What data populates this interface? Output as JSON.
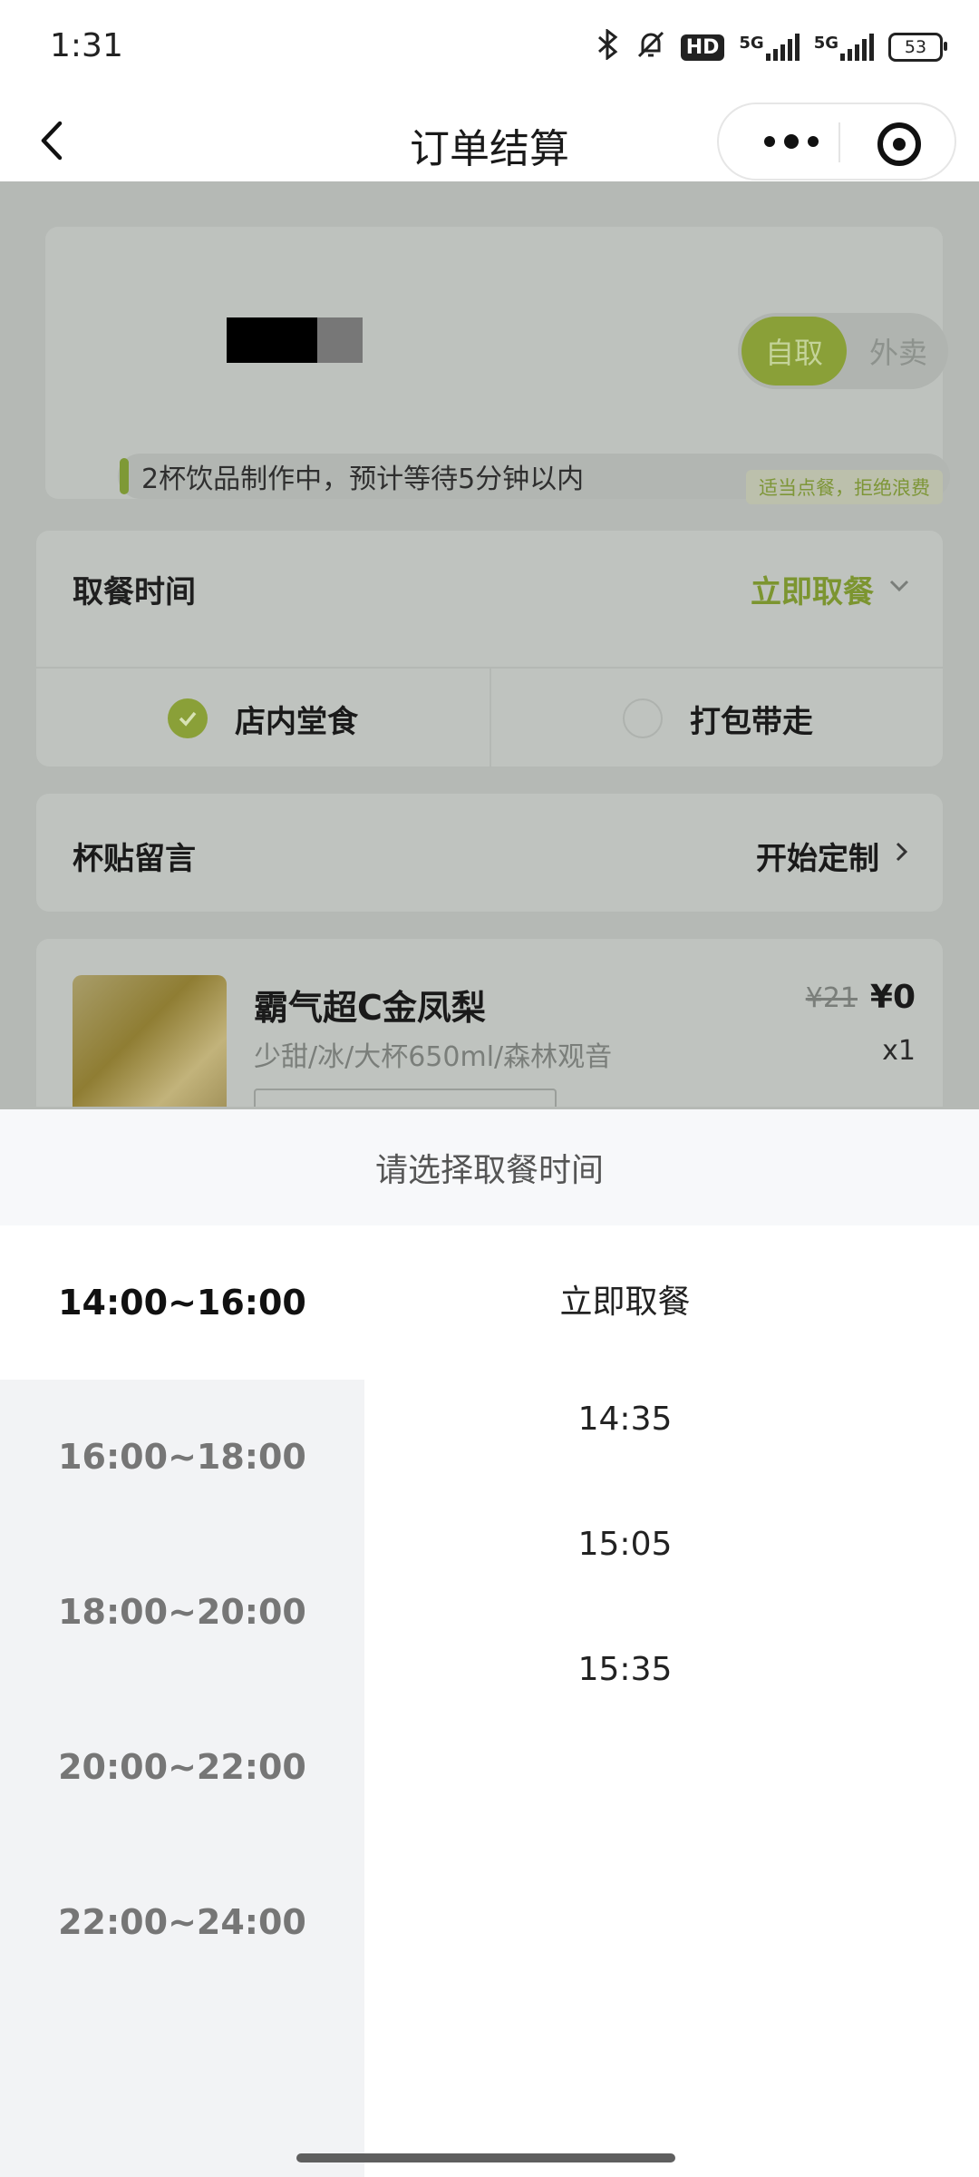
{
  "status": {
    "time": "1:31",
    "hd": "HD",
    "net1": "5G",
    "net2": "5G",
    "battery": "53"
  },
  "nav": {
    "title": "订单结算"
  },
  "store": {
    "toggle_pickup": "自取",
    "toggle_delivery": "外卖",
    "brew_status": "2杯饮品制作中，预计等待5分钟以内",
    "slogan": "适当点餐，拒绝浪费"
  },
  "pickup_time": {
    "label": "取餐时间",
    "value": "立即取餐",
    "dine_in": "店内堂食",
    "takeaway": "打包带走",
    "dine_in_selected": true
  },
  "sticker": {
    "label": "杯贴留言",
    "action": "开始定制"
  },
  "product": {
    "name": "霸气超C金凤梨",
    "spec": "少甜/冰/大杯650ml/森林观音",
    "original_price": "¥21",
    "price": "¥0",
    "qty": "x1"
  },
  "sheet": {
    "title": "请选择取餐时间",
    "slots": [
      "14:00~16:00",
      "16:00~18:00",
      "18:00~20:00",
      "20:00~22:00",
      "22:00~24:00"
    ],
    "active_slot_index": 0,
    "options": [
      "立即取餐",
      "14:35",
      "15:05",
      "15:35"
    ]
  },
  "colors": {
    "accent": "#8aa038",
    "accent_text": "#7c9530",
    "overlay": "#b5b9b5"
  },
  "icons": {
    "back": "chevron-left-icon",
    "more": "more-dots-icon",
    "close": "target-circle-icon",
    "check": "check-icon",
    "dropdown": "chevron-down-icon",
    "arrow": "chevron-right-icon"
  }
}
